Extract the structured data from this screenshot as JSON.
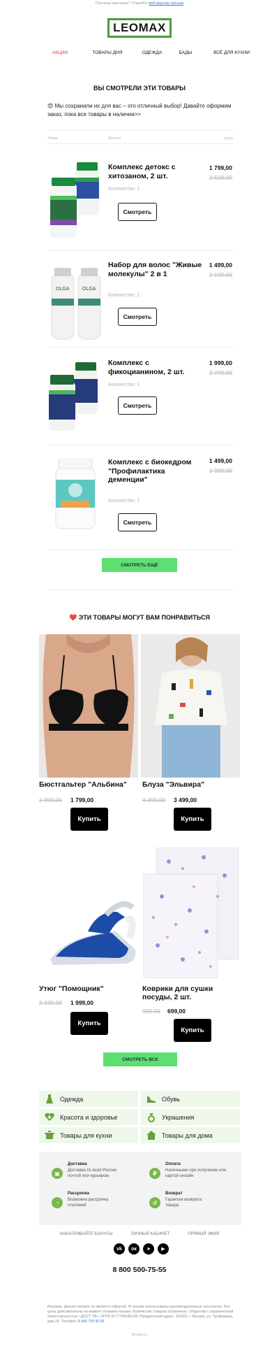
{
  "preheader": {
    "text": "Пропали картинки? Откройте ",
    "link": "веб-версию письма"
  },
  "logo": "LEOMAX",
  "nav": [
    "АКЦИИ",
    "ТОВАРЫ ДНЯ",
    "ОДЕЖДА",
    "БАДЫ",
    "ВСЁ ДЛЯ КУХНИ"
  ],
  "viewed": {
    "title": "ВЫ СМОТРЕЛИ ЭТИ ТОВАРЫ",
    "intro": "😍 Мы сохранили их для вас – это отличный выбор! Давайте оформим заказ, пока все товары в наличии>>",
    "headers": [
      "Товар",
      "Детали",
      "Цена"
    ],
    "items": [
      {
        "name": "Комплекс детокс с хитозаном, 2 шт.",
        "qty": "Количество: 1",
        "price": "1 799,00",
        "old_price": "2 599,00",
        "button": "Смотреть"
      },
      {
        "name": "Набор для волос \"Живые молекулы\" 2 в 1",
        "qty": "Количество: 1",
        "price": "1 499,00",
        "old_price": "2 199,00",
        "button": "Смотреть"
      },
      {
        "name": "Комплекс с фикоцианином, 2 шт.",
        "qty": "Количество: 1",
        "price": "1 999,00",
        "old_price": "2 799,00",
        "button": "Смотреть"
      },
      {
        "name": "Комплекс с биокедром \"Профилактика деменции\"",
        "qty": "Количество: 1",
        "price": "1 499,00",
        "old_price": "1 999,00",
        "button": "Смотреть"
      }
    ],
    "more_button": "СМОТРЕТЬ ЕЩЁ"
  },
  "recommend": {
    "title": "ЭТИ ТОВАРЫ МОГУТ ВАМ ПОНРАВИТЬСЯ",
    "heart": "❤️",
    "items": [
      {
        "name": "Бюстгальтер \"Альбина\"",
        "old_price": "2 999,00",
        "price": "1 799,00",
        "button": "Купить"
      },
      {
        "name": "Блуза \"Эльвира\"",
        "old_price": "4 399,00",
        "price": "3 499,00",
        "button": "Купить"
      },
      {
        "name": "Утюг \"Помощник\"",
        "old_price": "2 199,00",
        "price": "1 999,00",
        "button": "Купить"
      },
      {
        "name": "Коврики для сушки посуды, 2 шт.",
        "old_price": "999,00",
        "price": "699,00",
        "button": "Купить"
      }
    ],
    "all_button": "СМОТРЕТЬ ВСЕ"
  },
  "categories": [
    {
      "label": "Одежда",
      "icon": "dress-icon"
    },
    {
      "label": "Обувь",
      "icon": "shoe-icon"
    },
    {
      "label": "Красота и здоровье",
      "icon": "heart-plus-icon"
    },
    {
      "label": "Украшения",
      "icon": "ring-icon"
    },
    {
      "label": "Товары для кухни",
      "icon": "pot-icon"
    },
    {
      "label": "Товары для дома",
      "icon": "house-icon"
    }
  ],
  "info": [
    {
      "title": "Доставка",
      "text": "Доставка по всей России почтой или курьером",
      "icon": "box-icon"
    },
    {
      "title": "Оплата",
      "text": "Наличными при получении или картой онлайн",
      "icon": "ruble-icon"
    },
    {
      "title": "Рассрочка",
      "text": "Возможна рассрочка платежей",
      "icon": "clock-icon"
    },
    {
      "title": "Возврат",
      "text": "Гарантия возврата товара",
      "icon": "return-icon"
    }
  ],
  "footer_links": [
    "НАКАПЛИВАЙТЕ БОНУСЫ",
    "ЛИЧНЫЙ КАБИНЕТ",
    "ПРЯМОЙ ЭФИР"
  ],
  "social": [
    {
      "icon": "vk-icon",
      "glyph": "vk"
    },
    {
      "icon": "ok-icon",
      "glyph": "ок"
    },
    {
      "icon": "telegram-icon",
      "glyph": "➤"
    },
    {
      "icon": "youtube-icon",
      "glyph": "▶"
    }
  ],
  "phone": "8 800 500-75-55",
  "legal": {
    "text": "Реклама. Данное письмо не является офертой. В письме использованы рекомендательные технологии. Все цены действительны на момент отправки письма. Количество товаров ограничено. Общество с ограниченной ответственностью «ДОСТ ТВ». ОГРН 5177746036128. Юридический адрес: 115432, г. Москва, ул. Трофимова, дом 24. Телефон: ",
    "phone_link": "8 495 755 80 65"
  },
  "bottom": "leomax.ru",
  "colors": {
    "accent_red": "#e0342b",
    "green_button": "#5fde72",
    "logo_green": "#4a9d3a",
    "category_bg": "#eef8ea"
  }
}
